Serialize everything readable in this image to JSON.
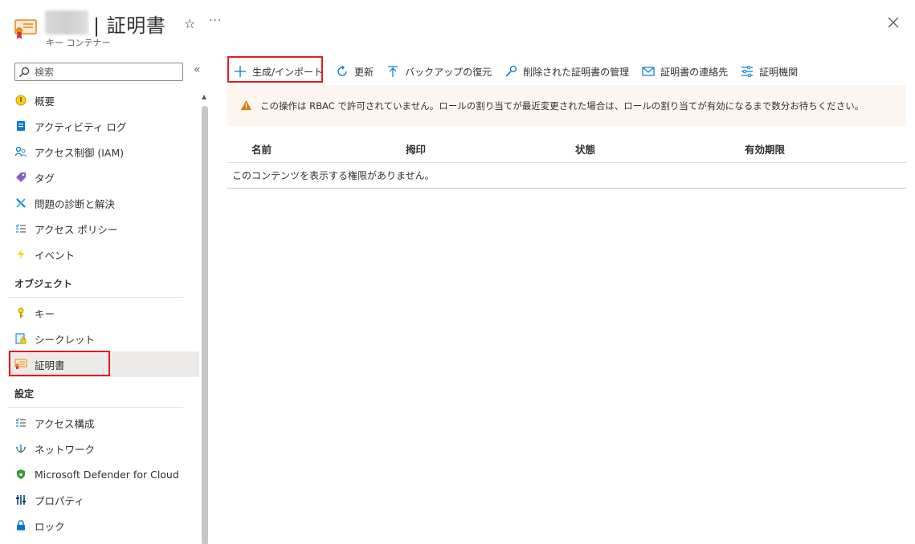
{
  "header": {
    "title": "| 証明書",
    "subtitle": "キー コンテナー",
    "star_icon": "star-icon",
    "more_label": "···",
    "close_icon": "close-icon"
  },
  "sidebar": {
    "search_placeholder": "検索",
    "collapse_label": "«",
    "items_top": [
      {
        "label": "概要",
        "icon": "overview-icon"
      },
      {
        "label": "アクティビティ ログ",
        "icon": "activity-log-icon"
      },
      {
        "label": "アクセス制御 (IAM)",
        "icon": "iam-icon"
      },
      {
        "label": "タグ",
        "icon": "tag-icon"
      },
      {
        "label": "問題の診断と解決",
        "icon": "diagnose-icon"
      },
      {
        "label": "アクセス ポリシー",
        "icon": "access-policy-icon"
      },
      {
        "label": "イベント",
        "icon": "event-icon"
      }
    ],
    "section_objects": "オブジェクト",
    "items_objects": [
      {
        "label": "キー",
        "icon": "key-icon"
      },
      {
        "label": "シークレット",
        "icon": "secret-icon"
      },
      {
        "label": "証明書",
        "icon": "certificate-icon",
        "selected": true
      }
    ],
    "section_settings": "設定",
    "items_settings": [
      {
        "label": "アクセス構成",
        "icon": "access-config-icon"
      },
      {
        "label": "ネットワーク",
        "icon": "network-icon"
      },
      {
        "label": "Microsoft Defender for Cloud",
        "icon": "defender-icon"
      },
      {
        "label": "プロパティ",
        "icon": "properties-icon"
      },
      {
        "label": "ロック",
        "icon": "lock-icon"
      }
    ]
  },
  "toolbar": {
    "generate_import": "生成/インポート",
    "refresh": "更新",
    "backup_restore": "バックアップの復元",
    "manage_deleted": "削除された証明書の管理",
    "contacts": "証明書の連絡先",
    "issuers": "証明機関"
  },
  "banner": {
    "text": "この操作は RBAC で許可されていません。ロールの割り当てが最近変更された場合は、ロールの割り当てが有効になるまで数分お待ちください。",
    "icon": "warning-icon"
  },
  "table": {
    "columns": [
      "名前",
      "拇印",
      "状態",
      "有効期限"
    ],
    "empty_message": "このコンテンツを表示する権限がありません。"
  },
  "colors": {
    "highlight": "#e11d1d",
    "selected_bg": "#edebe9",
    "banner_bg": "#fdf6f0",
    "accent": "#0078d4",
    "warning": "#d97a0b"
  }
}
